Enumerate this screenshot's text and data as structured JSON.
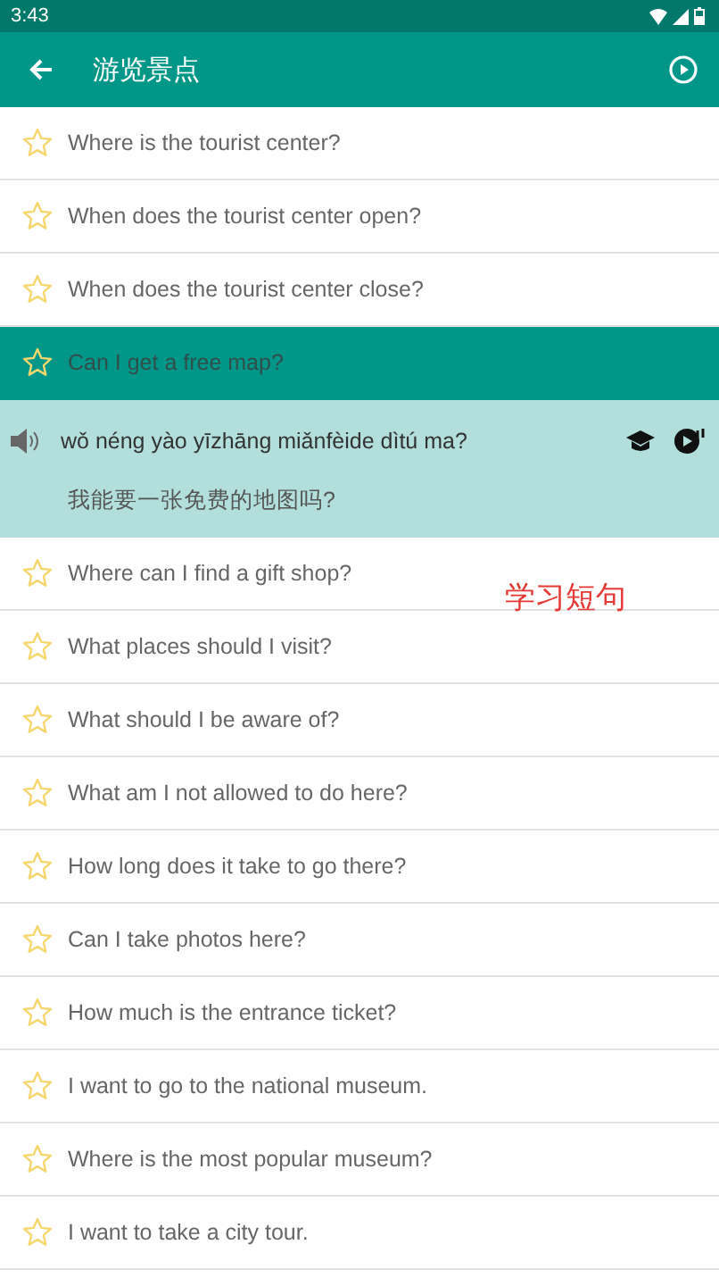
{
  "status_bar": {
    "time": "3:43"
  },
  "toolbar": {
    "title": "游览景点"
  },
  "caption": "学习短句",
  "phrases": [
    {
      "text": "Where is the tourist center?",
      "selected": false
    },
    {
      "text": "When does the tourist center open?",
      "selected": false
    },
    {
      "text": "When does the tourist center close?",
      "selected": false
    },
    {
      "text": "Can I get a free map?",
      "selected": true,
      "expanded": true,
      "pinyin": "wǒ néng yào yīzhāng miǎnfèide dìtú ma?",
      "chinese": "我能要一张免费的地图吗?"
    },
    {
      "text": "Where can I find a gift shop?",
      "selected": false
    },
    {
      "text": "What places should I visit?",
      "selected": false
    },
    {
      "text": "What should I be aware of?",
      "selected": false
    },
    {
      "text": "What am I not allowed to do here?",
      "selected": false
    },
    {
      "text": "How long does it take to go there?",
      "selected": false
    },
    {
      "text": "Can I take photos here?",
      "selected": false
    },
    {
      "text": "How much is the entrance ticket?",
      "selected": false
    },
    {
      "text": "I want to go to the national museum.",
      "selected": false
    },
    {
      "text": "Where is the most popular museum?",
      "selected": false
    },
    {
      "text": "I want to take a city tour.",
      "selected": false
    }
  ]
}
